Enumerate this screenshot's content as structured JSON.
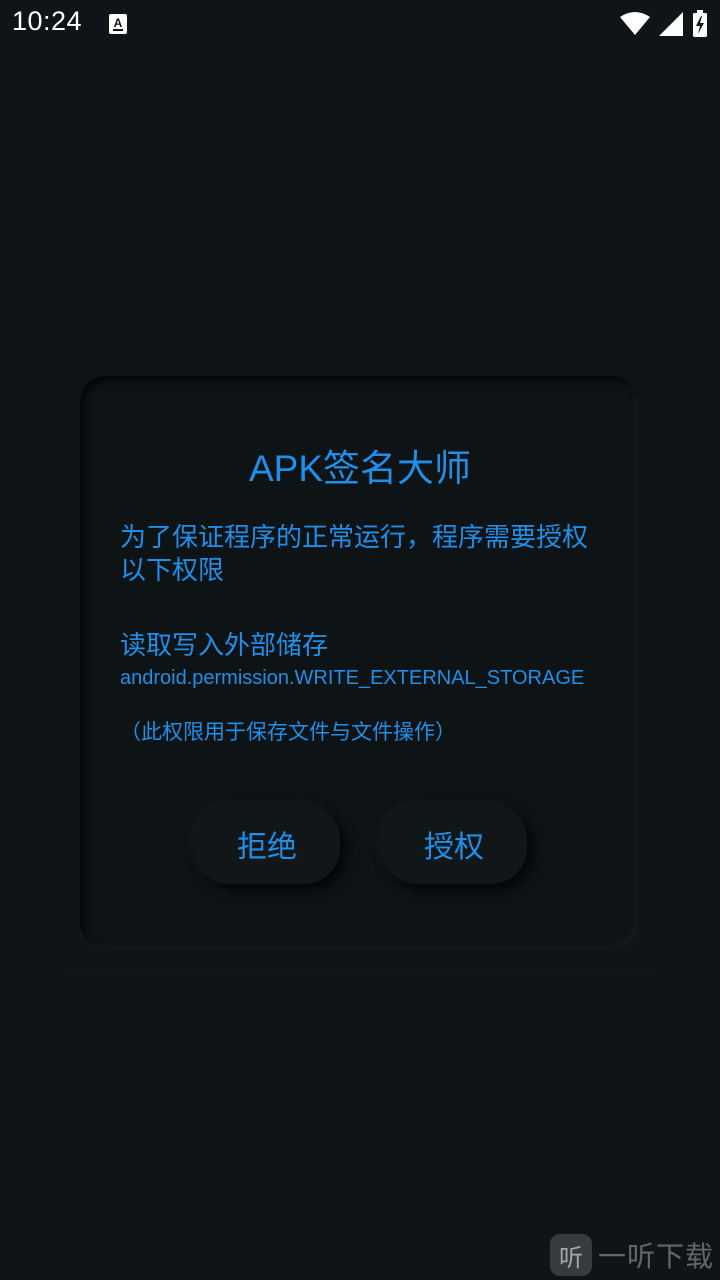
{
  "status_bar": {
    "time": "10:24",
    "app_icon_letter": "A",
    "icons": [
      "wifi-icon",
      "cell-signal-icon",
      "battery-charging-icon"
    ]
  },
  "dialog": {
    "title": "APK签名大师",
    "description": "为了保证程序的正常运行，程序需要授权以下权限",
    "permission_name": "读取写入外部储存",
    "permission_id": "android.permission.WRITE_EXTERNAL_STORAGE",
    "permission_note": "（此权限用于保存文件与文件操作）",
    "reject_label": "拒绝",
    "grant_label": "授权"
  },
  "watermark": {
    "logo_char": "听",
    "text": "一听下载"
  },
  "colors": {
    "background": "#0f1416",
    "accent": "#1f8fea"
  }
}
